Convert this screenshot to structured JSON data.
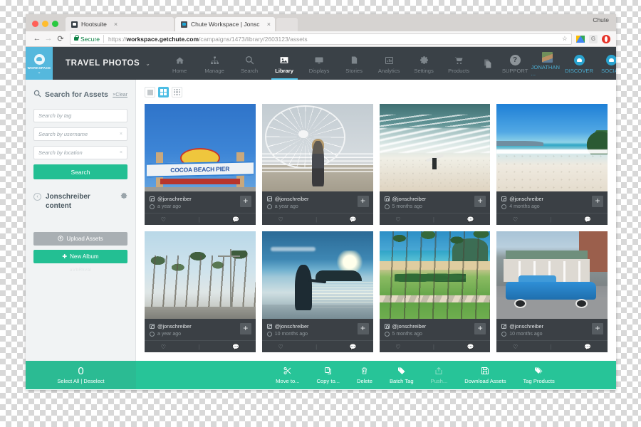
{
  "browser": {
    "tabs": [
      {
        "title": "Hootsuite",
        "favicon": "hootsuite-favicon",
        "active": false,
        "close": "×"
      },
      {
        "title": "Chute Workspace | Jonschreib",
        "favicon": "chute-favicon",
        "active": true,
        "close": "×"
      }
    ],
    "profile_name": "Chute",
    "nav": {
      "back": "←",
      "forward": "→",
      "reload": "⟳"
    },
    "omnibox": {
      "secure_label": "Secure",
      "scheme": "https://",
      "host": "workspace.getchute.com",
      "path": "/campaigns/1473/library/2603123/assets",
      "star": "☆"
    },
    "extensions": [
      "google-drive-icon",
      "grammarly-icon",
      "opera-icon"
    ]
  },
  "topnav": {
    "workspace": {
      "label": "WORKSPACE",
      "caret": "⌄"
    },
    "brand": {
      "label": "TRAVEL PHOTOS",
      "caret": "⌄"
    },
    "items": [
      {
        "label": "Home",
        "icon": "home-icon",
        "active": false
      },
      {
        "label": "Manage",
        "icon": "sitemap-icon",
        "active": false
      },
      {
        "label": "Search",
        "icon": "search-icon",
        "active": false
      },
      {
        "label": "Library",
        "icon": "image-icon",
        "active": true
      },
      {
        "label": "Displays",
        "icon": "monitor-icon",
        "active": false
      },
      {
        "label": "Stories",
        "icon": "document-icon",
        "active": false
      },
      {
        "label": "Analytics",
        "icon": "bar-chart-icon",
        "active": false
      },
      {
        "label": "Settings",
        "icon": "gear-icon",
        "active": false
      },
      {
        "label": "Products",
        "icon": "cart-icon",
        "active": false
      }
    ],
    "right_items": [
      {
        "label": "SUPPORT",
        "icon": "question-circle-icon"
      },
      {
        "label": "JONATHAN ...",
        "icon": "user-avatar"
      },
      {
        "label": "DISCOVER",
        "icon": "cloud-circle-icon"
      },
      {
        "label": "SOCIAL",
        "icon": "cloud-circle-icon"
      }
    ],
    "copy_icon": "copy-icon"
  },
  "sidebar": {
    "search_panel": {
      "title": "Search for Assets",
      "icon": "search-icon",
      "clear_label": "Clear",
      "clear_x": "×",
      "fields": [
        {
          "placeholder": "Search by tag",
          "value": "",
          "clear": ""
        },
        {
          "placeholder": "Search by username",
          "value": "",
          "clear": "×"
        },
        {
          "placeholder": "Search by location",
          "value": "",
          "clear": "×"
        }
      ],
      "submit_label": "Search"
    },
    "album": {
      "back_icon": "back-arrow-icon",
      "title": "Jonschreiber content",
      "gear_icon": "gear-icon",
      "upload_label": "Upload Assets",
      "upload_icon": "upload-icon",
      "new_album_label": "New Album",
      "new_album_icon": "plus-icon",
      "faint_note": "aVbRkval"
    }
  },
  "content": {
    "view_modes": [
      {
        "name": "list-view",
        "icon": "single-square-icon",
        "active": false
      },
      {
        "name": "grid-view",
        "icon": "four-square-grid-icon",
        "active": true
      },
      {
        "name": "compact-view",
        "icon": "nine-square-grid-icon",
        "active": false
      }
    ],
    "assets": [
      {
        "photo": "cocoa-beach-pier-sign",
        "username": "@jonschreiber",
        "time": "a year ago",
        "add": "+",
        "like_icon": "heart-icon",
        "comment_icon": "comment-icon"
      },
      {
        "photo": "ferris-wheel-boardwalk",
        "username": "@jonschreiber",
        "time": "a year ago",
        "add": "+",
        "like_icon": "heart-icon",
        "comment_icon": "comment-icon"
      },
      {
        "photo": "surfer-ocean-wave",
        "username": "@jonschreiber",
        "time": "5 months ago",
        "add": "+",
        "like_icon": "heart-icon",
        "comment_icon": "comment-icon"
      },
      {
        "photo": "white-sand-beach",
        "username": "@jonschreiber",
        "time": "4 months ago",
        "add": "+",
        "like_icon": "heart-icon",
        "comment_icon": "comment-icon"
      },
      {
        "photo": "palm-tree-street",
        "username": "@jonschreiber",
        "time": "a year ago",
        "add": "+",
        "like_icon": "heart-icon",
        "comment_icon": "comment-icon"
      },
      {
        "photo": "child-at-sunset-beach",
        "username": "@jonschreiber",
        "time": "10 months ago",
        "add": "+",
        "like_icon": "heart-icon",
        "comment_icon": "comment-icon"
      },
      {
        "photo": "tropical-lawn-palms",
        "username": "@jonschreiber",
        "time": "5 months ago",
        "add": "+",
        "like_icon": "heart-icon",
        "comment_icon": "comment-icon"
      },
      {
        "photo": "blue-vintage-car",
        "username": "@jonschreiber",
        "time": "10 months ago",
        "add": "+",
        "like_icon": "heart-icon",
        "comment_icon": "comment-icon"
      }
    ]
  },
  "actionbar": {
    "count": "0",
    "select_all": "Select All",
    "separator": "|",
    "deselect": "Deselect",
    "tools": [
      {
        "label": "Move to...",
        "icon": "scissors-icon",
        "enabled": true
      },
      {
        "label": "Copy to...",
        "icon": "copy-icon",
        "enabled": true
      },
      {
        "label": "Delete",
        "icon": "trash-icon",
        "enabled": true
      },
      {
        "label": "Batch Tag",
        "icon": "tag-icon",
        "enabled": true
      },
      {
        "label": "Push...",
        "icon": "share-icon",
        "enabled": false
      },
      {
        "label": "Download Assets",
        "icon": "save-icon",
        "enabled": true
      },
      {
        "label": "Tag Products",
        "icon": "tags-icon",
        "enabled": true
      }
    ]
  },
  "colors": {
    "accent_teal": "#27c498",
    "accent_blue": "#4cbde4",
    "nav_dark": "#3a4147",
    "card_dark": "#3b4045",
    "secure_green": "#0b8043"
  }
}
